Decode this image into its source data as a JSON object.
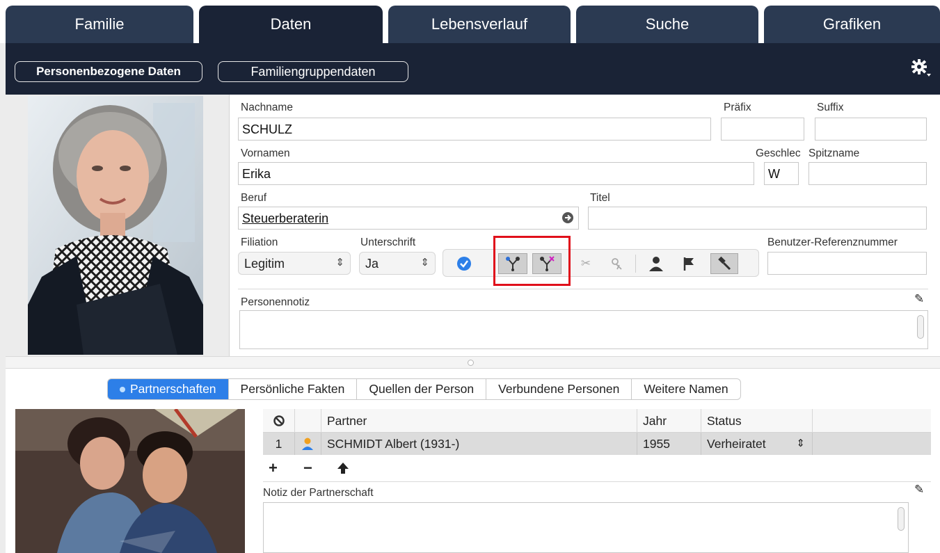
{
  "tabs": [
    {
      "label": "Familie"
    },
    {
      "label": "Daten"
    },
    {
      "label": "Lebensverlauf"
    },
    {
      "label": "Suche"
    },
    {
      "label": "Grafiken"
    }
  ],
  "subbar": {
    "personal_label": "Personenbezogene Daten",
    "family_group_label": "Familiengruppendaten",
    "settings_icon": "gear-icon"
  },
  "form": {
    "surname_label": "Nachname",
    "surname_value": "SCHULZ",
    "prefix_label": "Präfix",
    "prefix_value": "",
    "suffix_label": "Suffix",
    "suffix_value": "",
    "given_names_label": "Vornamen",
    "given_names_value": "Erika",
    "sex_label": "Geschlec",
    "sex_value": "W",
    "nickname_label": "Spitzname",
    "nickname_value": "",
    "occupation_label": "Beruf",
    "occupation_value": "Steuerberaterin",
    "title_label": "Titel",
    "title_value": "",
    "filiation_label": "Filiation",
    "filiation_value": "Legitim",
    "signature_label": "Unterschrift",
    "signature_value": "Ja",
    "user_ref_label": "Benutzer-Referenznummer",
    "user_ref_value": "",
    "person_note_label": "Personennotiz"
  },
  "lower": {
    "subtabs": [
      {
        "label": "Partnerschaften"
      },
      {
        "label": "Persönliche Fakten"
      },
      {
        "label": "Quellen der Person"
      },
      {
        "label": "Verbundene Personen"
      },
      {
        "label": "Weitere Namen"
      }
    ],
    "columns": {
      "partner": "Partner",
      "year": "Jahr",
      "status": "Status"
    },
    "rows": [
      {
        "num": "1",
        "partner": "SCHMIDT Albert (1931-)",
        "year": "1955",
        "status": "Verheiratet"
      }
    ],
    "add_label": "+",
    "remove_label": "−",
    "partnership_note_label": "Notiz der Partnerschaft"
  },
  "colors": {
    "tab_bg": "#2b3a52",
    "toolbar_bg": "#1a2336",
    "selected_subtab": "#2d7fe8",
    "highlight_box": "#e0101b"
  }
}
